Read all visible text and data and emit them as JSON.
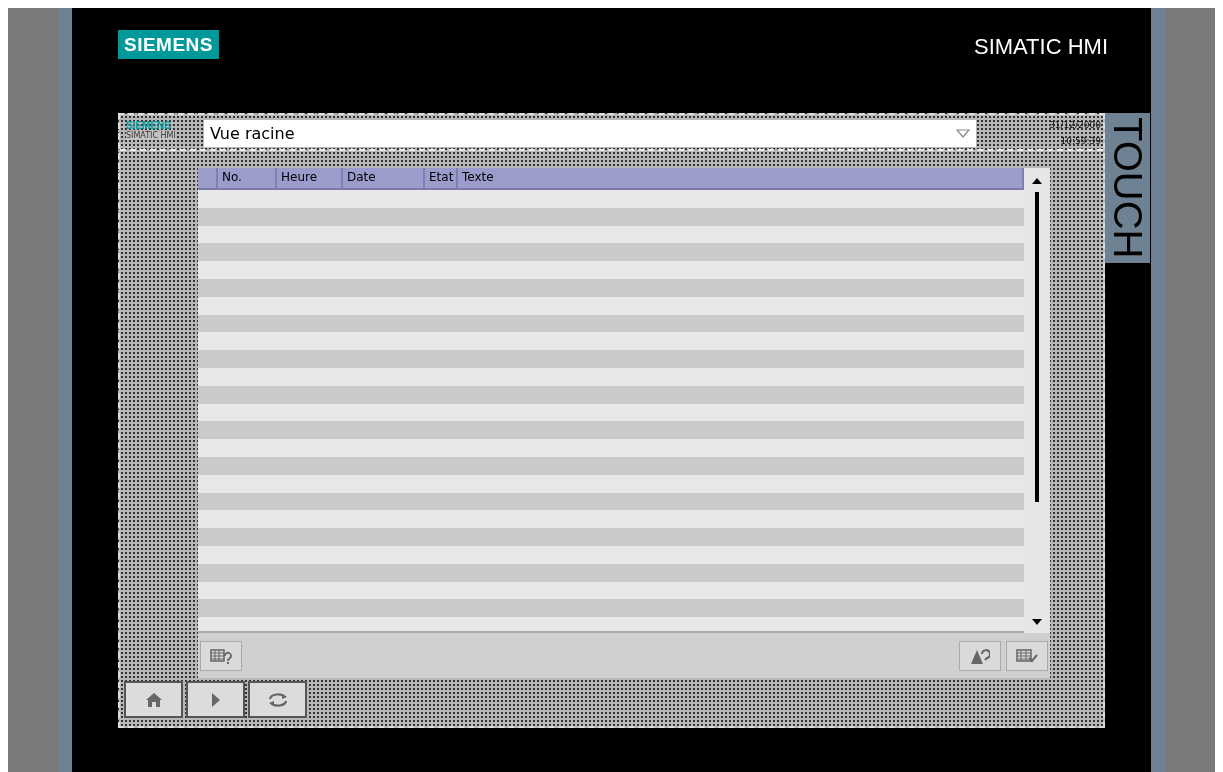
{
  "device": {
    "brand": "SIEMENS",
    "model": "SIMATIC HMI",
    "side_label": "TOUCH"
  },
  "screen": {
    "logo": "SIEMENS",
    "logo_sub": "SIMATIC HMI",
    "screen_select": {
      "value": "Vue racine"
    },
    "date": "31/12/2000",
    "time": "10:59:39"
  },
  "alarm_table": {
    "columns": [
      "",
      "No.",
      "Heure",
      "Date",
      "Etat",
      "Texte"
    ]
  },
  "toolbar": {
    "left": [
      {
        "kind": "info"
      }
    ],
    "right": [
      {
        "kind": "acknowledge"
      },
      {
        "kind": "edit"
      }
    ]
  },
  "nav_buttons": [
    {
      "kind": "home"
    },
    {
      "kind": "next"
    },
    {
      "kind": "refresh"
    }
  ]
}
